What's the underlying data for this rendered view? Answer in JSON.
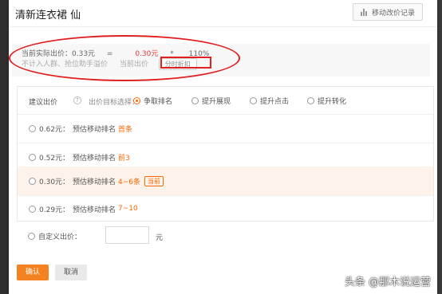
{
  "dialog": {
    "title": "清新连衣裙 仙"
  },
  "header": {
    "history_label": "移动改价记录"
  },
  "info": {
    "current_bid_label": "当前实际出价：0.33元",
    "eq": "=",
    "price_red": "0.30元",
    "times": "*",
    "pct": "110%",
    "note": "不计入人群、抢位助手溢价",
    "current_bid": "当前出价",
    "discount_label": "分时折扣"
  },
  "bid": {
    "label": "建议出价",
    "help": "?",
    "target_label": "出价目标选择：",
    "targets": [
      {
        "label": "争取排名",
        "selected": true
      },
      {
        "label": "提升展现",
        "selected": false
      },
      {
        "label": "提升点击",
        "selected": false
      },
      {
        "label": "提升转化",
        "selected": false
      }
    ],
    "options": [
      {
        "price": "0.62元：",
        "rank_label": "预估移动排名",
        "rank_value": "首条",
        "current": false
      },
      {
        "price": "0.52元：",
        "rank_label": "预估移动排名",
        "rank_value": "前3",
        "current": false
      },
      {
        "price": "0.30元：",
        "rank_label": "预估移动排名",
        "rank_value": "4~6条",
        "current": true,
        "current_tag": "当前"
      },
      {
        "price": "0.29元：",
        "rank_label": "预估移动排名",
        "rank_value": "7~10",
        "current": false
      }
    ]
  },
  "custom": {
    "label": "自定义出价：",
    "unit": "元"
  },
  "buttons": {
    "confirm": "确认",
    "cancel": "取消"
  },
  "watermark": "头条 @那木说运营",
  "colors": {
    "accent": "#f58220",
    "red_annotation": "#e02020",
    "price_red": "#e4393c"
  }
}
